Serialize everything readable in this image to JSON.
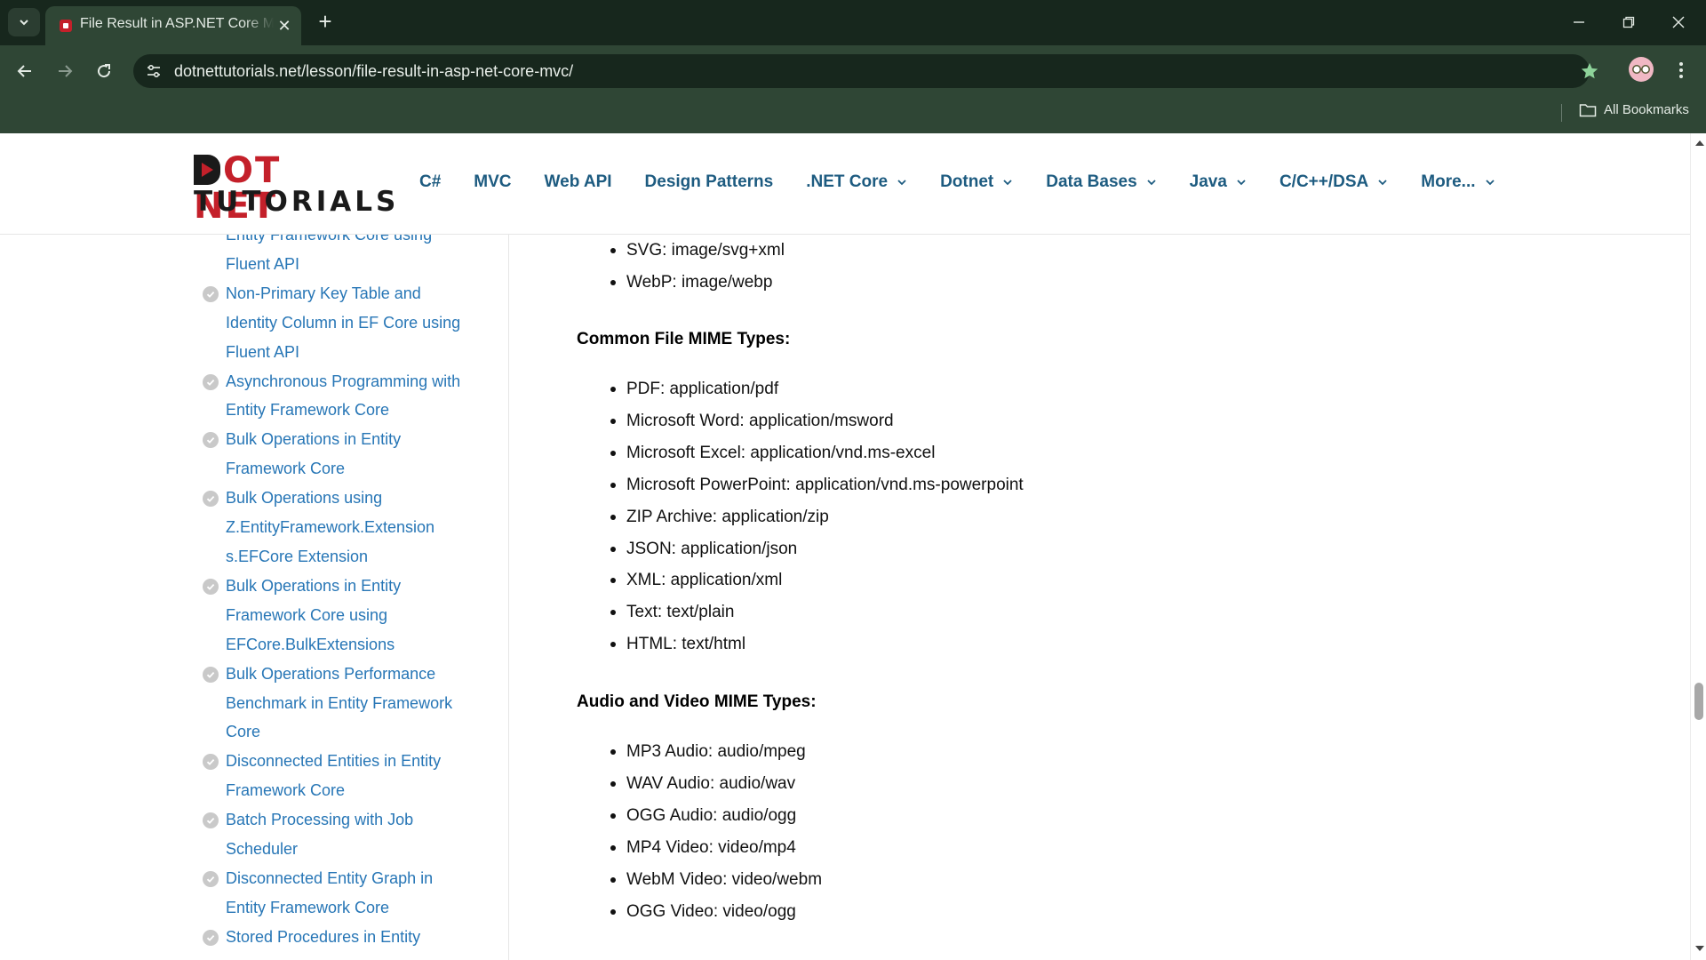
{
  "browser": {
    "tab_title": "File Result in ASP.NET Core MVC",
    "url": "dotnettutorials.net/lesson/file-result-in-asp-net-core-mvc/",
    "bookmarks_label": "All Bookmarks"
  },
  "logo": {
    "line1": "OT NET",
    "line2": "TUTORIALS"
  },
  "nav": [
    {
      "label": "C#"
    },
    {
      "label": "MVC"
    },
    {
      "label": "Web API"
    },
    {
      "label": "Design Patterns"
    },
    {
      "label": ".NET Core"
    },
    {
      "label": "Dotnet"
    },
    {
      "label": "Data Bases"
    },
    {
      "label": "Java"
    },
    {
      "label": "C/C++/DSA"
    },
    {
      "label": "More..."
    }
  ],
  "sidebar": {
    "items": [
      {
        "text": "Entity Framework Core using Fluent API"
      },
      {
        "text": "Non-Primary Key Table and Identity Column in EF Core using Fluent API"
      },
      {
        "text": "Asynchronous Programming with Entity Framework Core"
      },
      {
        "text": "Bulk Operations in Entity Framework Core"
      },
      {
        "text": "Bulk Operations using Z.EntityFramework.Extension s.EFCore Extension"
      },
      {
        "text": "Bulk Operations in Entity Framework Core using EFCore.BulkExtensions"
      },
      {
        "text": "Bulk Operations Performance Benchmark in Entity Framework Core"
      },
      {
        "text": "Disconnected Entities in Entity Framework Core"
      },
      {
        "text": "Batch Processing with Job Scheduler"
      },
      {
        "text": "Disconnected Entity Graph in Entity Framework Core"
      },
      {
        "text": "Stored Procedures in Entity"
      }
    ]
  },
  "content": {
    "image_types_tail": [
      "SVG: image/svg+xml",
      "WebP: image/webp"
    ],
    "file_heading": "Common File MIME Types:",
    "file_types": [
      "PDF: application/pdf",
      "Microsoft Word: application/msword",
      "Microsoft Excel: application/vnd.ms-excel",
      "Microsoft PowerPoint: application/vnd.ms-powerpoint",
      "ZIP Archive: application/zip",
      "JSON: application/json",
      "XML: application/xml",
      "Text: text/plain",
      "HTML: text/html"
    ],
    "av_heading": "Audio and Video MIME Types:",
    "av_types": [
      "MP3 Audio: audio/mpeg",
      "WAV Audio: audio/wav",
      "OGG Audio: audio/ogg",
      "MP4 Video: video/mp4",
      "WebM Video: video/webm",
      "OGG Video: video/ogg"
    ]
  },
  "colors": {
    "chrome_dark": "#17271d",
    "chrome_toolbar": "#2f4635",
    "nav_link": "#1d5b80",
    "sidebar_link": "#2776b6",
    "logo_red": "#c4202a"
  }
}
